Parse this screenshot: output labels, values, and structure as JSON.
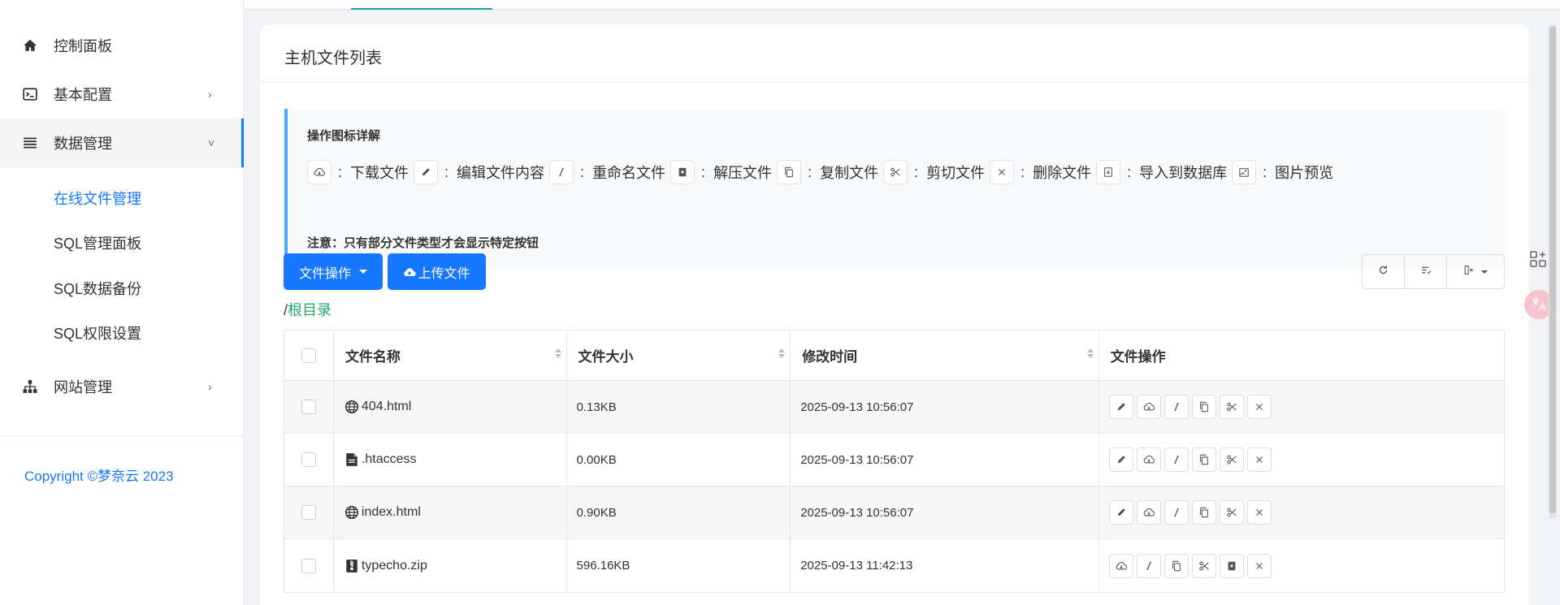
{
  "sidebar": {
    "items": [
      {
        "label": "控制面板",
        "icon": "home-icon"
      },
      {
        "label": "基本配置",
        "icon": "terminal-icon",
        "chevron": "›"
      },
      {
        "label": "数据管理",
        "icon": "list-icon",
        "chevron": "˅"
      },
      {
        "label": "网站管理",
        "icon": "sitemap-icon",
        "chevron": "›"
      }
    ],
    "sub_items": [
      {
        "label": "在线文件管理",
        "active": true
      },
      {
        "label": "SQL管理面板"
      },
      {
        "label": "SQL数据备份"
      },
      {
        "label": "SQL权限设置"
      }
    ],
    "copyright": "Copyright ©梦奈云 2023"
  },
  "card": {
    "title": "主机文件列表"
  },
  "notice": {
    "title": "操作图标详解",
    "legend": [
      {
        "icon": "download-icon",
        "colon": ":",
        "label": "下载文件"
      },
      {
        "icon": "edit-icon",
        "colon": ":",
        "label": "编辑文件内容"
      },
      {
        "icon": "rename-icon",
        "colon": ":",
        "label": "重命名文件"
      },
      {
        "icon": "unzip-icon",
        "colon": ":",
        "label": "解压文件"
      },
      {
        "icon": "copy-icon",
        "colon": ":",
        "label": "复制文件"
      },
      {
        "icon": "cut-icon",
        "colon": ":",
        "label": "剪切文件"
      },
      {
        "icon": "delete-icon",
        "colon": ":",
        "label": "删除文件"
      },
      {
        "icon": "import-icon",
        "colon": ":",
        "label": "导入到数据库"
      },
      {
        "icon": "image-preview-icon",
        "colon": ":",
        "label": "图片预览"
      }
    ],
    "note": "注意：只有部分文件类型才会显示特定按钮"
  },
  "toolbar": {
    "file_ops_label": "文件操作",
    "upload_label": "上传文件"
  },
  "breadcrumb": {
    "separator": "/",
    "root": "根目录"
  },
  "table": {
    "headers": [
      "文件名称",
      "文件大小",
      "修改时间",
      "文件操作"
    ],
    "rows": [
      {
        "icon": "globe-icon",
        "name": "404.html",
        "size": "0.13KB",
        "mtime": "2025-09-13 10:56:07",
        "actions": [
          "edit",
          "download",
          "rename",
          "copy",
          "cut",
          "delete"
        ]
      },
      {
        "icon": "file-icon",
        "name": ".htaccess",
        "size": "0.00KB",
        "mtime": "2025-09-13 10:56:07",
        "actions": [
          "edit",
          "download",
          "rename",
          "copy",
          "cut",
          "delete"
        ]
      },
      {
        "icon": "globe-icon",
        "name": "index.html",
        "size": "0.90KB",
        "mtime": "2025-09-13 10:56:07",
        "actions": [
          "edit",
          "download",
          "rename",
          "copy",
          "cut",
          "delete"
        ]
      },
      {
        "icon": "zip-icon",
        "name": "typecho.zip",
        "size": "596.16KB",
        "mtime": "2025-09-13 11:42:13",
        "actions": [
          "download",
          "rename",
          "copy",
          "cut",
          "unzip",
          "delete"
        ]
      }
    ]
  },
  "colors": {
    "primary": "#1677ff",
    "breadcrumb": "#21ab6c",
    "notice_border": "#4dabf7"
  }
}
